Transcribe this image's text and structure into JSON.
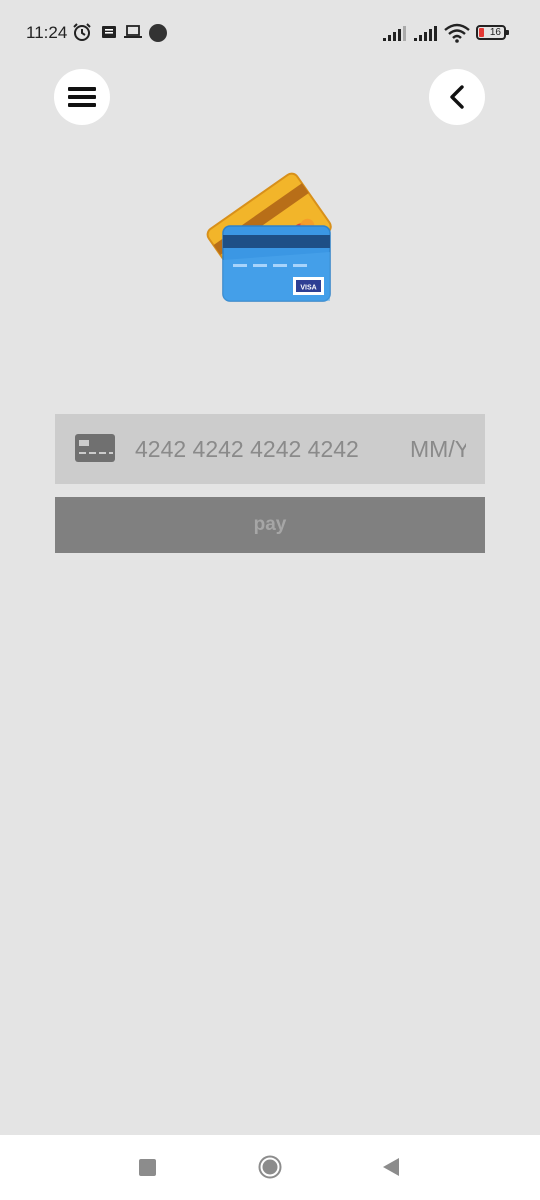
{
  "status_bar": {
    "time": "11:24",
    "battery_level": "16",
    "icons": [
      "alarm-icon",
      "notification-icon",
      "laptop-icon",
      "dot-icon",
      "signal-icon",
      "signal-icon",
      "wifi-icon",
      "battery-icon"
    ]
  },
  "header": {
    "menu_icon": "hamburger-menu-icon",
    "back_icon": "chevron-left-icon"
  },
  "illustration": {
    "icon": "credit-cards-icon",
    "card_badge": "VISA"
  },
  "card_form": {
    "card_icon": "credit-card-icon",
    "card_number_placeholder": "4242 4242 4242 4242",
    "expiry_placeholder": "MM/YY",
    "pay_label": "pay"
  },
  "nav_bar": {
    "recent_icon": "square-recent-icon",
    "home_icon": "circle-home-icon",
    "back_icon": "triangle-back-icon"
  },
  "colors": {
    "background": "#e4e4e4",
    "input_bg": "#cccccc",
    "pay_button_bg": "#808080",
    "pay_button_text": "#a6a6a6",
    "placeholder": "#8a8a8a"
  }
}
